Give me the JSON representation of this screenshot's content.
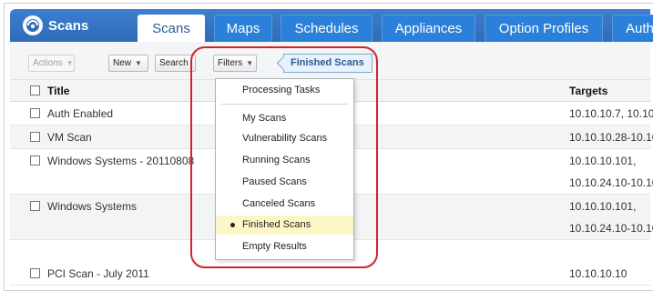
{
  "nav": {
    "logo_label": "Scans",
    "tabs": [
      {
        "label": "Scans",
        "active": true
      },
      {
        "label": "Maps"
      },
      {
        "label": "Schedules"
      },
      {
        "label": "Appliances"
      },
      {
        "label": "Option Profiles"
      },
      {
        "label": "Auth"
      }
    ]
  },
  "toolbar": {
    "actions_label": "Actions",
    "new_label": "New",
    "search_label": "Search",
    "filters_label": "Filters",
    "active_filter": "Finished Scans"
  },
  "table": {
    "columns": {
      "title": "Title",
      "targets": "Targets"
    },
    "rows": [
      {
        "title": "Auth Enabled",
        "targets": [
          "10.10.10.7, 10.10.1"
        ]
      },
      {
        "title": "VM Scan",
        "targets": [
          "10.10.10.28-10.10."
        ]
      },
      {
        "title": "Windows Systems - 20110808",
        "targets": [
          "10.10.10.101,",
          "10.10.24.10-10.10."
        ]
      },
      {
        "title": "Windows Systems",
        "targets": [
          "10.10.10.101,",
          "10.10.24.10-10.10."
        ]
      },
      {
        "title": "PCI Scan - July 2011",
        "targets": [
          "10.10.10.10"
        ]
      }
    ]
  },
  "filter_menu": {
    "items": [
      {
        "label": "Processing Tasks"
      },
      {
        "label": "My Scans"
      },
      {
        "label": "Vulnerability Scans"
      },
      {
        "label": "Running Scans"
      },
      {
        "label": "Paused Scans"
      },
      {
        "label": "Canceled Scans"
      },
      {
        "label": "Finished Scans",
        "selected": true
      },
      {
        "label": "Empty Results"
      }
    ]
  },
  "colors": {
    "nav_blue": "#2f6bb8",
    "selected_item": "#fbf7c7",
    "annotation_red": "#d2232a",
    "filter_pill": "#e9f1fb"
  }
}
